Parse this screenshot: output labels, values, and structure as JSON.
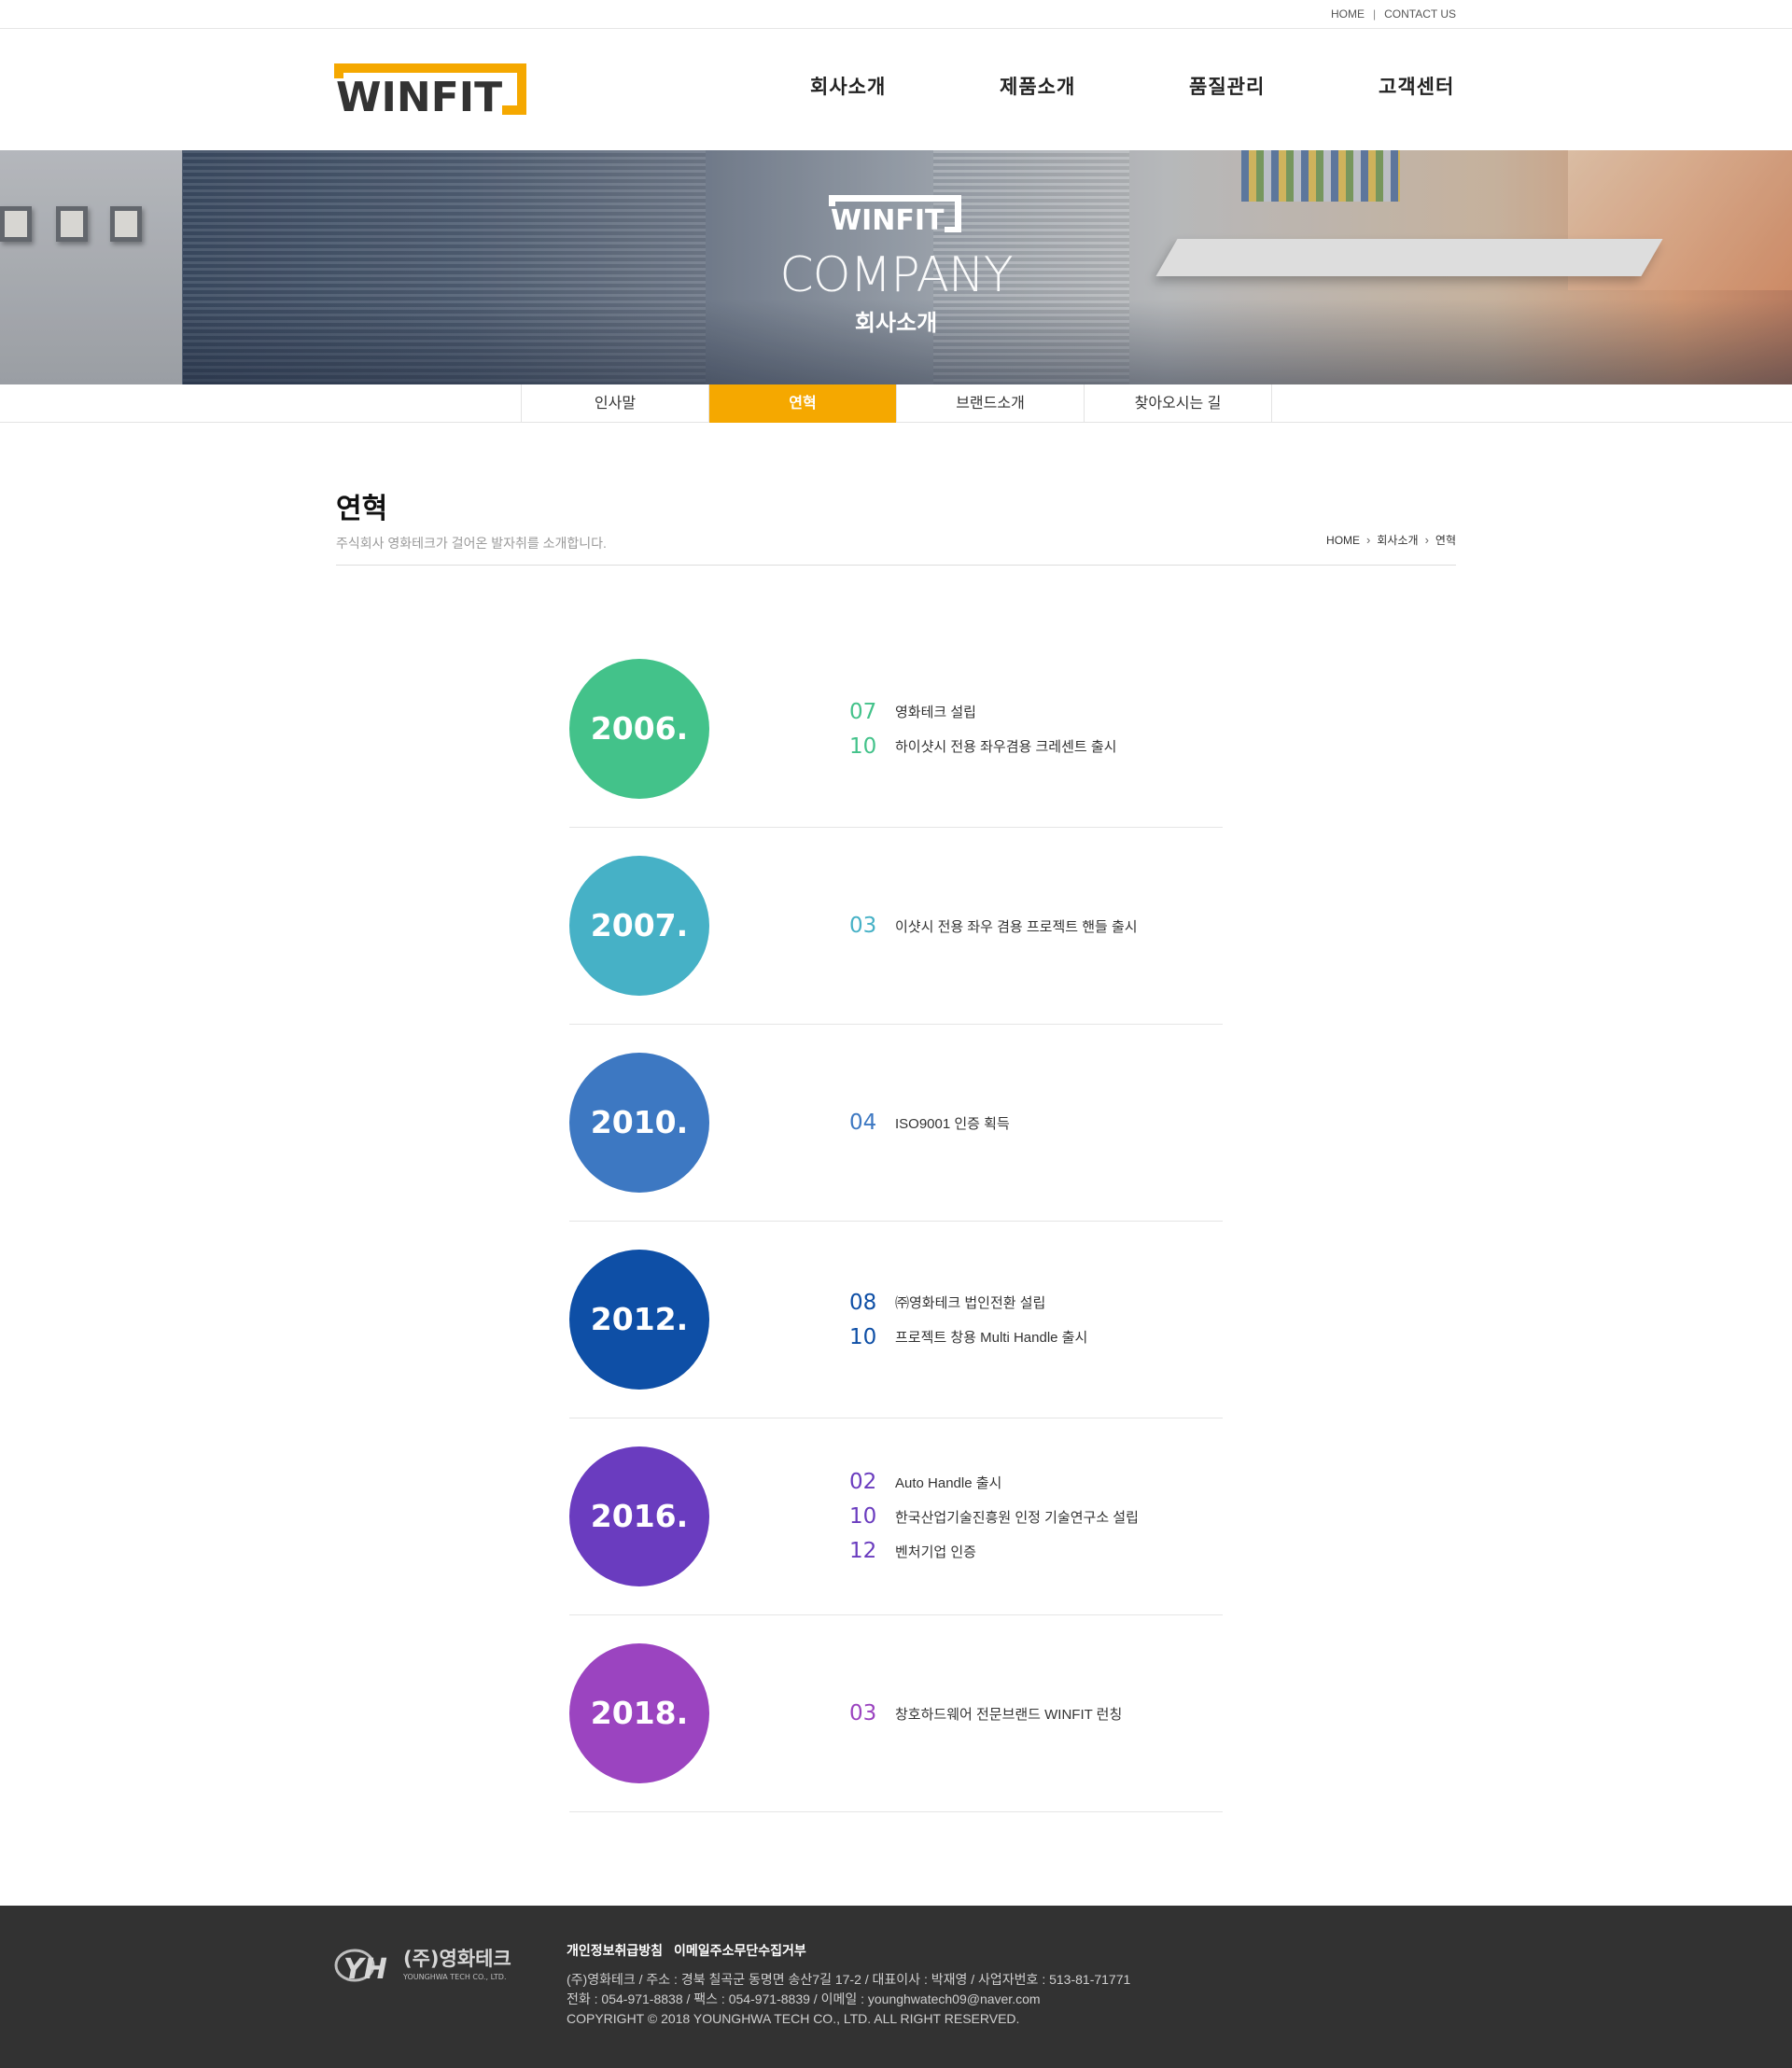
{
  "topbar": {
    "home": "HOME",
    "divider": "|",
    "contact": "CONTACT US"
  },
  "brand": {
    "logo_text": "WINFIT",
    "accent": "#f5a800"
  },
  "nav": [
    {
      "label": "회사소개"
    },
    {
      "label": "제품소개"
    },
    {
      "label": "품질관리"
    },
    {
      "label": "고객센터"
    }
  ],
  "banner": {
    "title": "COMPANY",
    "subtitle": "회사소개",
    "logo_text": "WINFIT"
  },
  "subnav": [
    {
      "label": "인사말",
      "active": false
    },
    {
      "label": "연혁",
      "active": true
    },
    {
      "label": "브랜드소개",
      "active": false
    },
    {
      "label": "찾아오시는 길",
      "active": false
    }
  ],
  "page": {
    "title": "연혁",
    "description": "주식회사 영화테크가 걸어온 발자취를 소개합니다.",
    "breadcrumb": [
      "HOME",
      "회사소개",
      "연혁"
    ]
  },
  "history": [
    {
      "year": "2006.",
      "color": "#43c28a",
      "events": [
        {
          "month": "07",
          "text": "영화테크 설립"
        },
        {
          "month": "10",
          "text": "하이샷시 전용 좌우겸용 크레센트 출시"
        }
      ]
    },
    {
      "year": "2007.",
      "color": "#46b1c6",
      "events": [
        {
          "month": "03",
          "text": "이샷시 전용 좌우 겸용 프로젝트 핸들 출시"
        }
      ]
    },
    {
      "year": "2010.",
      "color": "#3d78c2",
      "events": [
        {
          "month": "04",
          "text": "ISO9001 인증 획득"
        }
      ]
    },
    {
      "year": "2012.",
      "color": "#0e4fa6",
      "events": [
        {
          "month": "08",
          "text": "㈜영화테크 법인전환 설립"
        },
        {
          "month": "10",
          "text": "프로젝트 창용 Multi Handle 출시"
        }
      ]
    },
    {
      "year": "2016.",
      "color": "#6a3cbf",
      "events": [
        {
          "month": "02",
          "text": "Auto Handle 출시"
        },
        {
          "month": "10",
          "text": "한국산업기술진흥원 인정 기술연구소 설립"
        },
        {
          "month": "12",
          "text": "벤처기업 인증"
        }
      ]
    },
    {
      "year": "2018.",
      "color": "#9b44c0",
      "events": [
        {
          "month": "03",
          "text": "창호하드웨어 전문브랜드 WINFIT 런칭"
        }
      ]
    }
  ],
  "footer": {
    "logo_mark": "YH",
    "logo_name": "(주)영화테크",
    "logo_sub": "YOUNGHWA TECH CO., LTD.",
    "links": [
      "개인정보취급방침",
      "이메일주소무단수집거부"
    ],
    "address": "(주)영화테크 / 주소 : 경북 칠곡군 동명면 송산7길 17-2 / 대표이사 : 박재영 / 사업자번호 : 513-81-71771",
    "contact": "전화 : 054-971-8838 / 팩스 : 054-971-8839 / 이메일 : younghwatech09@naver.com",
    "copyright": "COPYRIGHT © 2018 YOUNGHWA TECH CO., LTD. ALL RIGHT RESERVED."
  }
}
